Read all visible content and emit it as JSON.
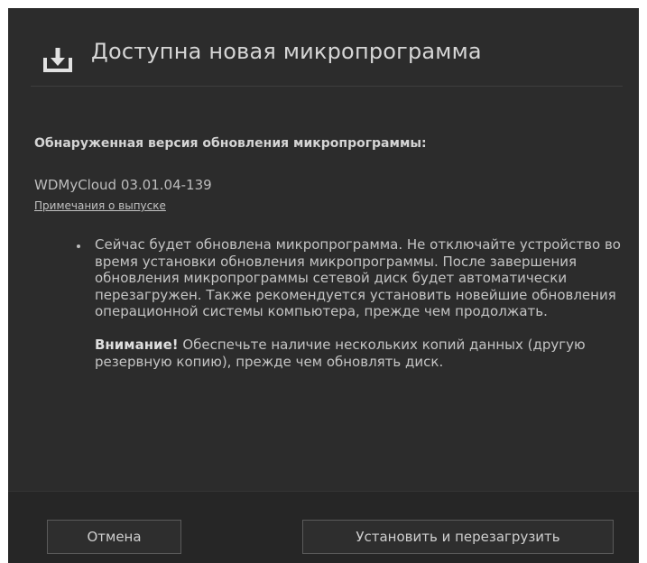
{
  "dialog": {
    "title": "Доступна новая микропрограмма",
    "icon": "download-icon"
  },
  "update": {
    "section_title": "Обнаруженная версия обновления микропрограммы:",
    "version": "WDMyCloud 03.01.04-139",
    "release_notes_link": "Примечания о выпуске"
  },
  "message": {
    "body": "Сейчас будет обновлена микропрограмма. Не отключайте устройство во время установки обновления микропрограммы. После завершения обновления микропрограммы сетевой диск будет автоматически перезагружен. Также рекомендуется установить новейшие обновления операционной системы компьютера, прежде чем продолжать.",
    "warning_label": "Внимание!",
    "warning_text": " Обеспечьте наличие нескольких копий данных (другую резервную копию), прежде чем обновлять диск."
  },
  "footer": {
    "cancel_label": "Отмена",
    "install_label": "Установить и перезагрузить"
  },
  "colors": {
    "dialog_background": "#2c2c2c",
    "footer_background": "#262626",
    "text": "#c4c4c4"
  }
}
